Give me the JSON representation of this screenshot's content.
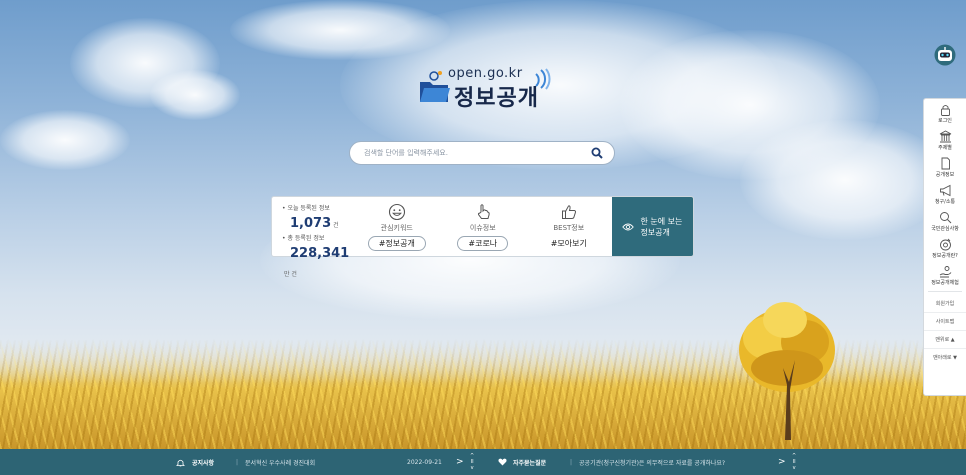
{
  "logo": {
    "domain": "open.go.kr",
    "title": "정보공개"
  },
  "search": {
    "placeholder": "검색할 단어를 입력해주세요."
  },
  "stats": {
    "today_label": "• 오늘 등록된 정보",
    "today_value": "1,073",
    "today_unit": "건",
    "total_label": "• 총 등록된 정보",
    "total_value": "228,341",
    "total_unit": "만 건"
  },
  "columns": [
    {
      "icon": "smile-icon",
      "label": "관심키워드",
      "tag": "#정보공개"
    },
    {
      "icon": "pointer-hand-icon",
      "label": "이슈정보",
      "tag": "#코로나"
    },
    {
      "icon": "thumbs-up-icon",
      "label": "BEST정보",
      "tag": "#모아보기"
    }
  ],
  "cta": {
    "line1": "한 눈에 보는",
    "line2": "정보공개"
  },
  "sidebar": {
    "items": [
      {
        "icon": "lock-icon",
        "label": "로그인"
      },
      {
        "icon": "building-icon",
        "label": "주제별"
      },
      {
        "icon": "document-icon",
        "label": "공개정보"
      },
      {
        "icon": "megaphone-icon",
        "label": "청구/소통"
      },
      {
        "icon": "search-icon",
        "label": "국민관심사항"
      },
      {
        "icon": "question-icon",
        "label": "정보공개란?"
      },
      {
        "icon": "hands-icon",
        "label": "정보공개체험"
      }
    ],
    "links": [
      "회원가입",
      "사이트맵",
      "맨위로 ▲",
      "맨아래로 ▼"
    ]
  },
  "bottom": {
    "notice_title": "공지사항",
    "notice_text": "문서혁신 우수사례 경진대회",
    "notice_date": "2022-09-21",
    "faq_title": "자주묻는질문",
    "faq_text": "공공기관(청구신청기관)은 의무적으로 자료를 공개하나요?",
    "pause_glyph": "II",
    "up_glyph": "^",
    "down_glyph": "v",
    "next_glyph": ">"
  },
  "colors": {
    "accent": "#2f6b7c",
    "navy": "#1f3d73",
    "bottom_bar": "#2d6474"
  }
}
